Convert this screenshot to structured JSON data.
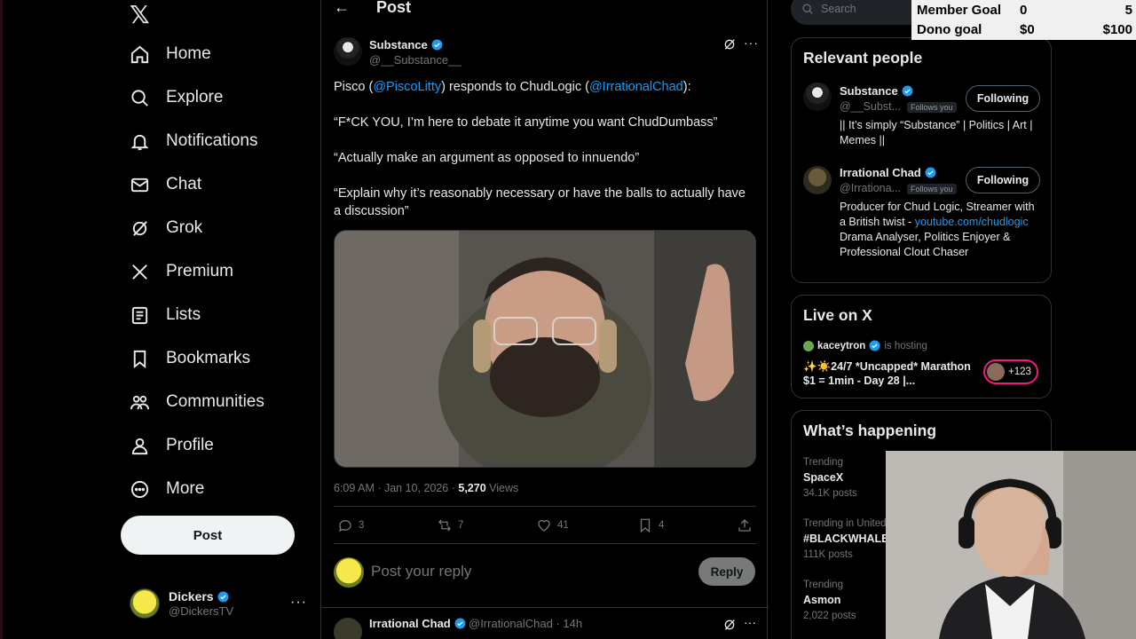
{
  "nav": {
    "items": [
      {
        "label": "Home",
        "icon": "home-icon"
      },
      {
        "label": "Explore",
        "icon": "search-icon"
      },
      {
        "label": "Notifications",
        "icon": "bell-icon"
      },
      {
        "label": "Chat",
        "icon": "mail-icon"
      },
      {
        "label": "Grok",
        "icon": "grok-icon"
      },
      {
        "label": "Premium",
        "icon": "x-icon"
      },
      {
        "label": "Lists",
        "icon": "list-icon"
      },
      {
        "label": "Bookmarks",
        "icon": "bookmark-icon"
      },
      {
        "label": "Communities",
        "icon": "people-icon"
      },
      {
        "label": "Profile",
        "icon": "person-icon"
      },
      {
        "label": "More",
        "icon": "more-circle-icon"
      }
    ],
    "post_label": "Post",
    "account": {
      "name": "Dickers",
      "handle": "@DickersTV"
    }
  },
  "header": {
    "title": "Post"
  },
  "post": {
    "author": "Substance",
    "handle": "@__Substance__",
    "line1_pre": "Pisco (",
    "mention1": "@PiscoLitty",
    "line1_mid": ") responds to ChudLogic (",
    "mention2": "@IrrationalChad",
    "line1_post": "):",
    "quote1": "“F*CK YOU, I’m here to debate it anytime you want ChudDumbass”",
    "quote2": "“Actually make an argument as opposed to innuendo”",
    "quote3": "“Explain why it’s reasonably necessary or have the balls to actually have a discussion”",
    "time": "6:09 AM · Jan 10, 2026 · ",
    "views_count": "5,270",
    "views_label": " Views",
    "replies": "3",
    "reposts": "7",
    "likes": "41",
    "bookmarks": "4"
  },
  "reply_box": {
    "placeholder": "Post your reply",
    "button": "Reply"
  },
  "next_reply": {
    "author": "Irrational Chad",
    "meta": "@IrrationalChad · 14h"
  },
  "search": {
    "placeholder": "Search"
  },
  "relevant": {
    "title": "Relevant people",
    "people": [
      {
        "name": "Substance",
        "handle": "@__Subst...",
        "follows_you": "Follows you",
        "button": "Following",
        "bio": "|| It’s simply “Substance” | Politics | Art | Memes ||"
      },
      {
        "name": "Irrational Chad",
        "handle": "@Irrationa...",
        "follows_you": "Follows you",
        "button": "Following",
        "bio_pre": "Producer for Chud Logic, Streamer with a British twist - ",
        "bio_link": "youtube.com/chudlogic",
        "bio_post": " Drama Analyser, Politics Enjoyer & Professional Clout Chaser"
      }
    ]
  },
  "live": {
    "title": "Live on X",
    "host": "kaceytron",
    "hosting": "is hosting",
    "stream_title": "✨☀️24/7 *Uncapped* Marathon $1 = 1min - Day 28 |...",
    "listeners": "+123"
  },
  "happening": {
    "title": "What’s happening",
    "trends": [
      {
        "context": "Trending",
        "name": "SpaceX",
        "posts": "34.1K posts"
      },
      {
        "context": "Trending in United",
        "name": "#BLACKWHALE",
        "posts": "111K posts"
      },
      {
        "context": "Trending",
        "name": "Asmon",
        "posts": "2,022 posts"
      }
    ]
  },
  "overlay": {
    "member_goal_label": "Member Goal",
    "member_goal_current": "0",
    "member_goal_target": "5",
    "dono_goal_label": "Dono goal",
    "dono_goal_current": "$0",
    "dono_goal_target": "$100"
  },
  "colors": {
    "accent": "#1d9bf0",
    "background": "#000000",
    "live_pink": "#f91880"
  }
}
